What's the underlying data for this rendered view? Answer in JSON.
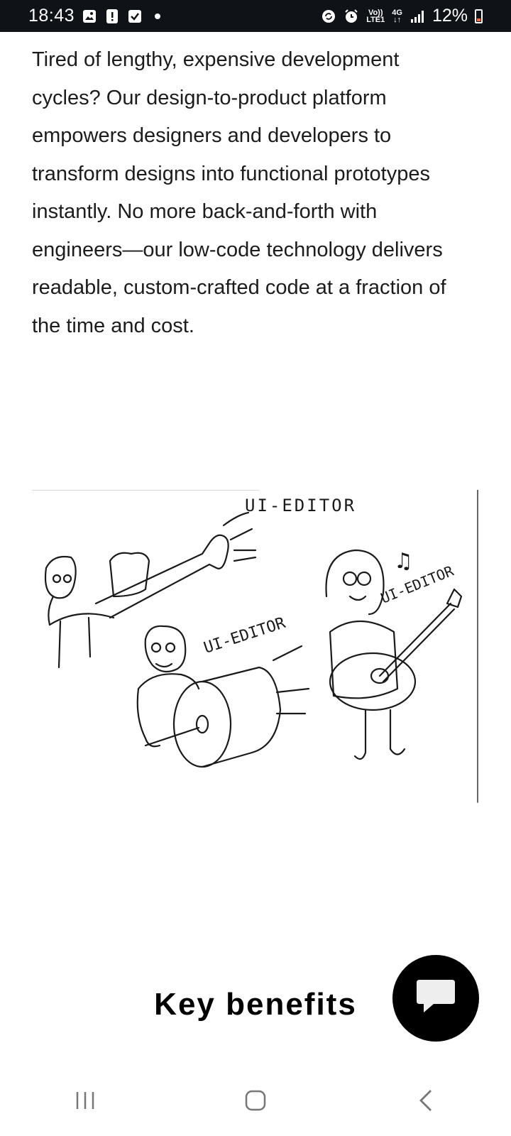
{
  "status_bar": {
    "time": "18:43",
    "network": {
      "volte": "Vo))",
      "lte": "LTE1",
      "gen": "4G"
    },
    "battery": "12%",
    "icons": [
      "gallery-icon",
      "alert-icon",
      "check-icon",
      "dot-icon",
      "sync-icon",
      "alarm-icon",
      "signal-icon",
      "battery-icon"
    ]
  },
  "intro": {
    "text": "Tired of lengthy, expensive development cycles? Our design-to-product platform empowers designers and developers to transform designs into functional prototypes instantly. No more back-and-forth with engineers—our low-code technology delivers readable, custom-crafted code at a fraction of the time and cost."
  },
  "illustration": {
    "labels": [
      "UI-EDITOR",
      "UI-EDITOR",
      "UI-EDITOR"
    ],
    "notes": "♫"
  },
  "section": {
    "heading": "Key benefits"
  },
  "chat": {
    "icon": "chat-bubble-icon"
  },
  "nav": {
    "icons": [
      "recent-apps-icon",
      "home-icon",
      "back-icon"
    ]
  },
  "colors": {
    "status_bg": "#0f1217",
    "battery_low": "#ff6a3c",
    "fab_bg": "#000000"
  }
}
